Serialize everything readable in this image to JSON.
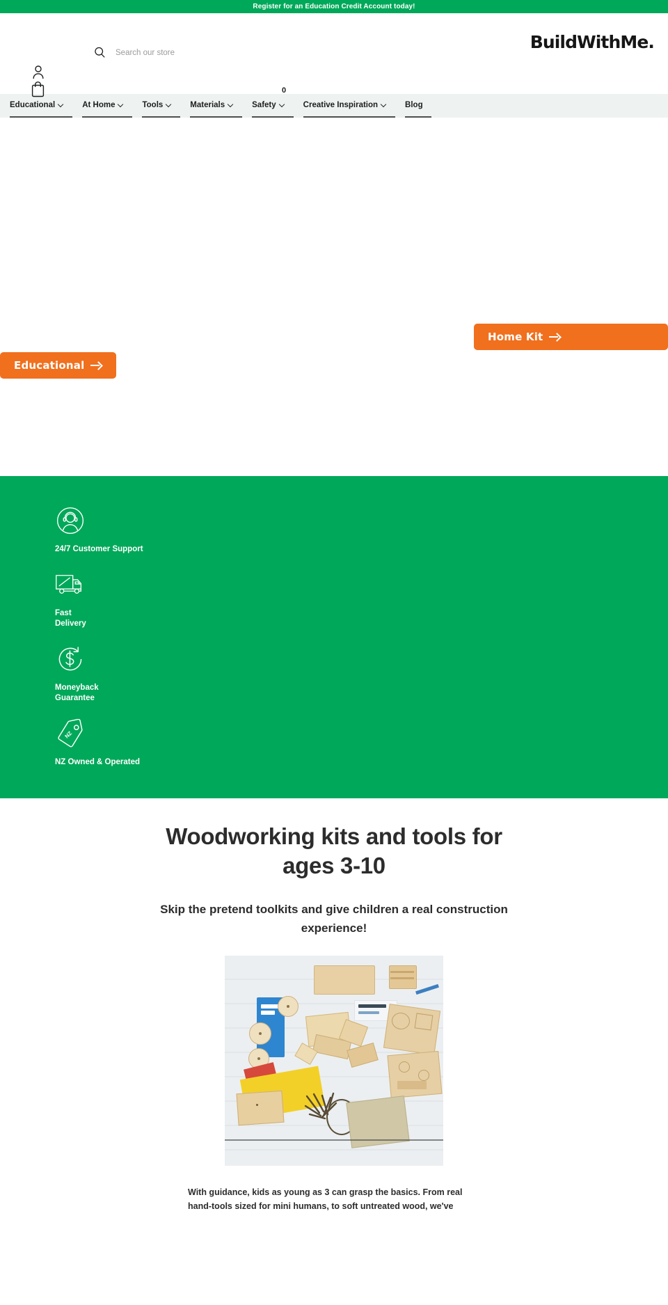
{
  "announcement": {
    "text": "Register for an Education Credit Account today!"
  },
  "header": {
    "logo": "BuildWithMe.",
    "search_placeholder": "Search our store",
    "search_value": "",
    "search_icon": "search-icon",
    "account_icon": "account-person-icon",
    "cart_icon": "shopping-bag-icon",
    "cart_count": "0"
  },
  "nav": {
    "items": [
      {
        "label": "Educational",
        "has_caret": true
      },
      {
        "label": "At Home",
        "has_caret": true
      },
      {
        "label": "Tools",
        "has_caret": true
      },
      {
        "label": "Materials",
        "has_caret": true
      },
      {
        "label": "Safety",
        "has_caret": true
      },
      {
        "label": "Creative Inspiration",
        "has_caret": true
      },
      {
        "label": "Blog",
        "has_caret": false
      }
    ]
  },
  "hero": {
    "buttons": [
      {
        "label": "Home Kit",
        "icon": "arrow-right-icon"
      },
      {
        "label": "Educational",
        "icon": "arrow-right-icon"
      }
    ],
    "accent_color": "#f0701e"
  },
  "features": {
    "background_color": "#00a859",
    "items": [
      {
        "icon": "headset-support-icon",
        "label": "24/7 Customer Support"
      },
      {
        "icon": "delivery-truck-icon",
        "label": "Fast\nDelivery"
      },
      {
        "icon": "dollar-refresh-icon",
        "label": "Moneyback\nGuarantee"
      },
      {
        "icon": "nz-price-tag-icon",
        "label": "NZ Owned & Operated"
      }
    ]
  },
  "content": {
    "heading": "Woodworking kits and tools for ages 3-10",
    "subheading": "Skip the pretend toolkits and give children a real construction experience!",
    "photo_alt": "flat-lay of wooden tow truck kit with screws, sandpaper and timber offcuts",
    "body": "With guidance, kids as young as 3 can grasp the basics. From real hand-tools sized for mini humans, to soft untreated wood, we've"
  }
}
